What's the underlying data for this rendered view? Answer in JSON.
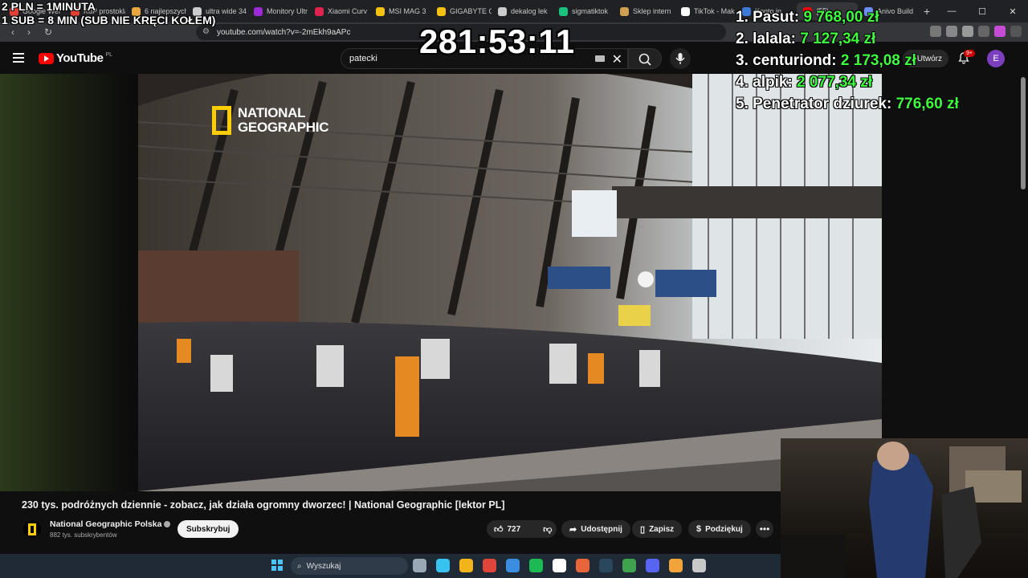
{
  "browser": {
    "tabs": [
      {
        "label": "Google Wer",
        "color": "#e34133"
      },
      {
        "label": "KuP prostoklątny",
        "color": "#e34133"
      },
      {
        "label": "6 najlepszych",
        "color": "#e8a73c"
      },
      {
        "label": "ultra wide 34",
        "color": "#cccccc"
      },
      {
        "label": "Monitory Ultr",
        "color": "#9b2bd6"
      },
      {
        "label": "Xiaomi Curv",
        "color": "#e0224f"
      },
      {
        "label": "MSI MAG 3",
        "color": "#f4c20d"
      },
      {
        "label": "GIGABYTE G",
        "color": "#f4c20d"
      },
      {
        "label": "dekalog lek",
        "color": "#cccccc"
      },
      {
        "label": "sigmatiktok",
        "color": "#19c37d"
      },
      {
        "label": "Sklep intern",
        "color": "#d0a050"
      },
      {
        "label": "TikTok - Mak",
        "color": "#ffffff"
      },
      {
        "label": "Konto in",
        "color": "#3c78d8"
      },
      {
        "label": "(55)",
        "color": "#ff0000"
      },
      {
        "label": "Anivo Build",
        "color": "#6c8ef5"
      }
    ],
    "new_tab": "+",
    "window": {
      "minimize": "—",
      "maximize": "☐",
      "close": "✕"
    },
    "url": "youtube.com/watch?v=-2mEkh9aAPc",
    "back": "‹",
    "forward": "›",
    "reload": "↻"
  },
  "youtube": {
    "logo_text": "YouTube",
    "region": "PL",
    "search_value": "patecki",
    "clear_symbol": "✕",
    "create_label": "Utwórz",
    "notifications_badge": "9+",
    "avatar_letter": "E"
  },
  "video": {
    "watermark": "NATIONAL\nGEOGRAPHIC",
    "title": "230 tys. podróżnych dziennie - zobacz, jak działa ogromny dworzec! | National Geographic [lektor PL]",
    "channel_name": "National Geographic Polska",
    "subscribers": "882 tys. subskrybentów",
    "subscribe_label": "Subskrybuj",
    "likes": "727",
    "share_label": "Udostępnij",
    "save_label": "Zapisz",
    "thanks_label": "Podziękuj",
    "more_symbol": "•••"
  },
  "overlay": {
    "rate_line1": "2 PLN = 1MINUTA",
    "rate_line2": "1 SUB = 8 MIN (SUB NIE KRĘCI KOŁEM)",
    "timer": "281:53:11",
    "leaderboard": [
      {
        "name": "1. Pasut:",
        "amount": "9 768,00 zł"
      },
      {
        "name": "2. lalala:",
        "amount": "7 127,34 zł"
      },
      {
        "name": "3. centuriond:",
        "amount": "2 173,08 zł"
      },
      {
        "name": "4. alpik:",
        "amount": "2 077,34 zł"
      },
      {
        "name": "5. Penetrator dziurek:",
        "amount": "776,60 zł"
      }
    ]
  },
  "taskbar": {
    "search_placeholder": "Wyszukaj",
    "apps": [
      "#9aa7b4",
      "#37c2f0",
      "#f3b41b",
      "#e0453a",
      "#3a8de0",
      "#1db954",
      "#ffffff",
      "#e8643a",
      "#2a475e",
      "#3fa34d",
      "#5865f2",
      "#f2a33a",
      "#c8c8c8"
    ]
  }
}
